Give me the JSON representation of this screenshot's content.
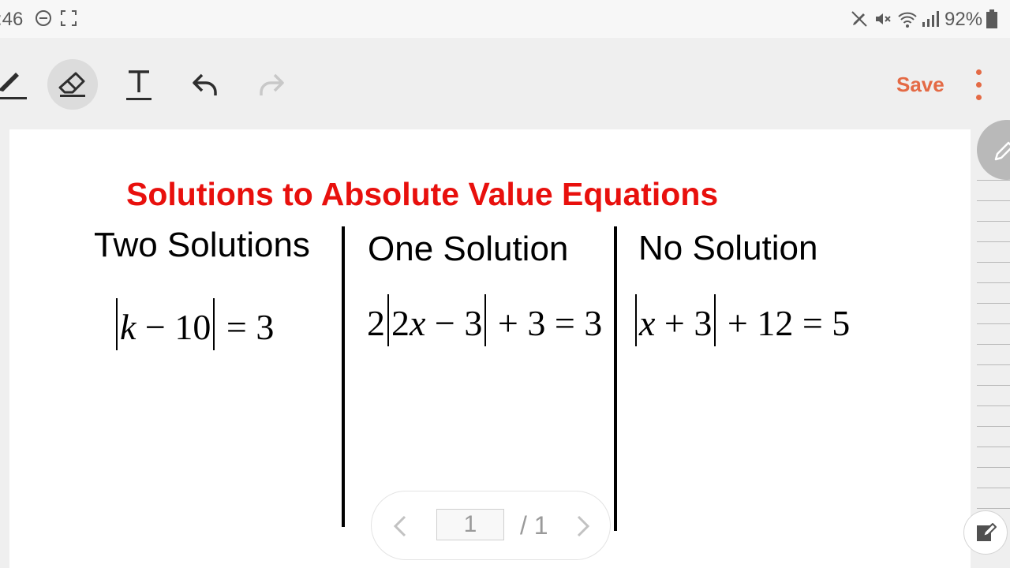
{
  "status_bar": {
    "time": ":46",
    "battery": "92%",
    "icons": [
      "do-not-disturb-icon",
      "screenshot-icon",
      "no-pen-icon",
      "mute-icon",
      "wifi-icon",
      "signal-icon",
      "battery-icon"
    ]
  },
  "toolbar": {
    "tools": [
      "pen-icon",
      "eraser-icon",
      "text-icon",
      "undo-icon",
      "redo-icon"
    ],
    "active_tool": "eraser-icon",
    "save_label": "Save",
    "accent_color": "#e46a45"
  },
  "document": {
    "title": "Solutions to Absolute Value Equations",
    "title_color": "#e8100d",
    "columns": [
      {
        "heading": "Two Solutions",
        "equation": {
          "lead": "",
          "inner": [
            "k",
            " − 10"
          ],
          "tail": " = 3"
        }
      },
      {
        "heading": "One Solution",
        "equation": {
          "lead": "2",
          "inner": [
            "2",
            "x",
            " − 3"
          ],
          "tail": " + 3 = 3"
        }
      },
      {
        "heading": "No Solution",
        "equation": {
          "lead": "",
          "inner": [
            "x",
            " + 3"
          ],
          "tail": " + 12 = 5"
        }
      }
    ]
  },
  "pager": {
    "current_page": "1",
    "total": "/ 1"
  }
}
